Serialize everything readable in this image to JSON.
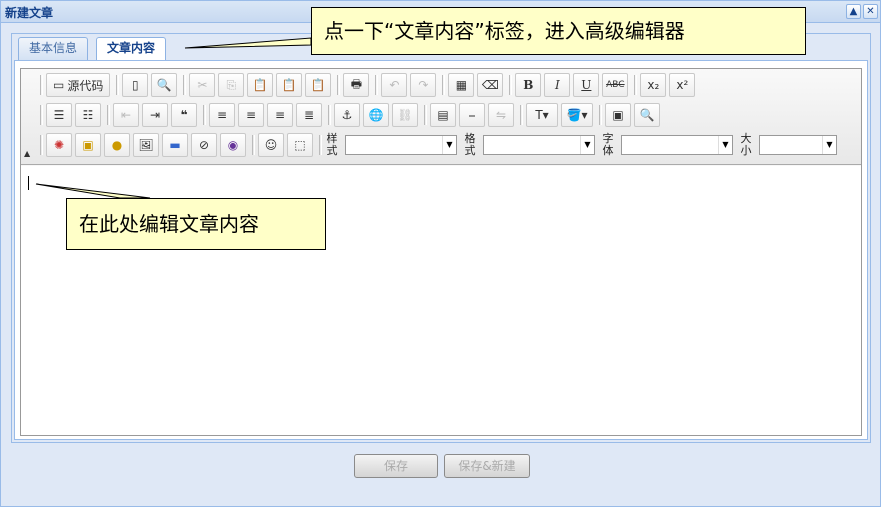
{
  "window": {
    "title": "新建文章",
    "collapse_icon": "▲",
    "close_icon": "✕"
  },
  "tabs": [
    {
      "label": "基本信息",
      "active": false
    },
    {
      "label": "文章内容",
      "active": true
    }
  ],
  "toolbar": {
    "row1": {
      "source_label": "源代码",
      "bold": "B",
      "italic": "I",
      "underline": "U",
      "strike": "ABC",
      "subscript": "x₂",
      "superscript": "x²"
    },
    "row3": {
      "style_label": "样式",
      "format_label": "格式",
      "font_label": "字体",
      "size_label": "大小"
    }
  },
  "editor": {
    "content": ""
  },
  "footer": {
    "save_label": "保存",
    "save_new_label": "保存&新建"
  },
  "callouts": {
    "top": "点一下“文章内容”标签，进入高级编辑器",
    "edit": "在此处编辑文章内容"
  },
  "colors": {
    "window_bg": "#dfe8f6",
    "border": "#99bbe8",
    "title_text": "#15428b",
    "callout_bg": "#ffffc8"
  }
}
